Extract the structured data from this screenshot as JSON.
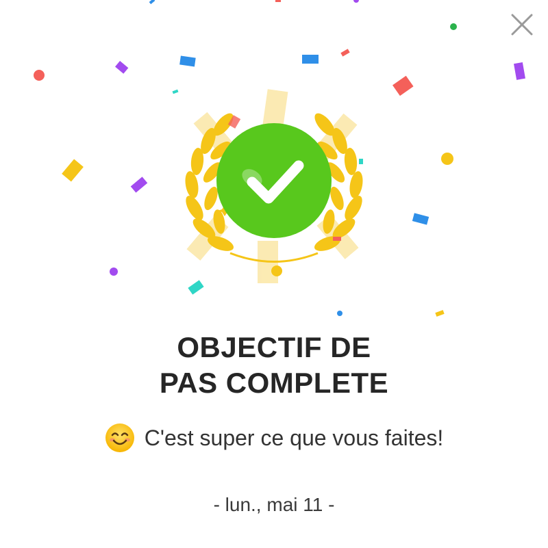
{
  "dialog": {
    "title_line1": "OBJECTIF DE",
    "title_line2": "PAS COMPLETE",
    "message": "C'est super ce que vous faites!",
    "date": "- lun., mai 11 -"
  },
  "icons": {
    "close": "close-icon",
    "badge": "checkmark-laurel-badge-icon",
    "emoji": "smiling-face-emoji-icon"
  },
  "colors": {
    "check_green": "#58c81d",
    "laurel_gold": "#f5c518",
    "title_text": "#262626",
    "close_gray": "#9a9a9a"
  }
}
